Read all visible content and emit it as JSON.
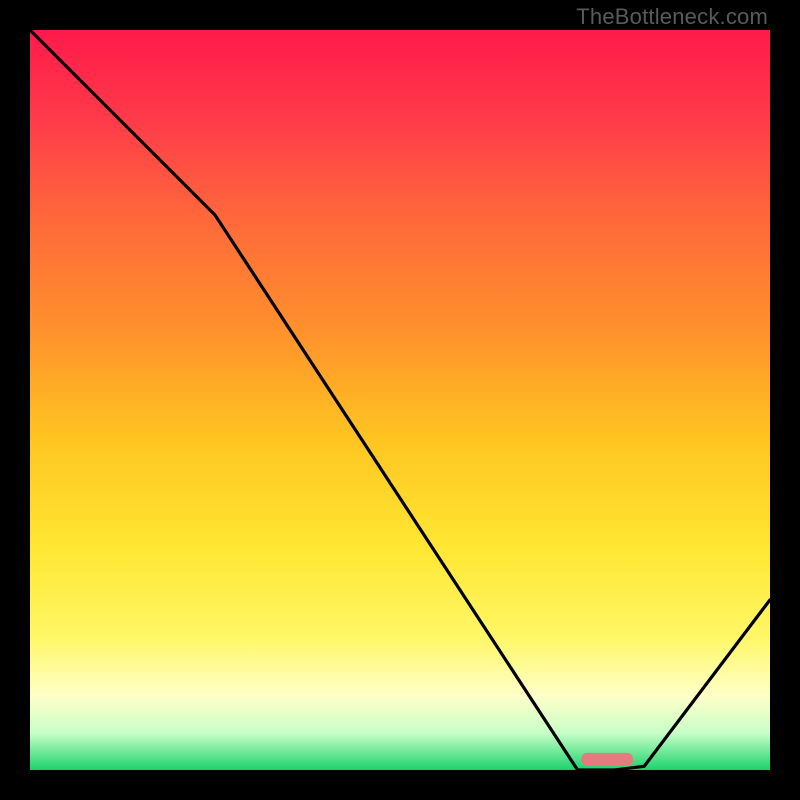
{
  "watermark": "TheBottleneck.com",
  "chart_data": {
    "type": "line",
    "title": "",
    "xlabel": "",
    "ylabel": "",
    "xlim": [
      0,
      100
    ],
    "ylim": [
      0,
      100
    ],
    "grid": false,
    "legend": false,
    "series": [
      {
        "name": "curve",
        "x": [
          0,
          25,
          74,
          79,
          83,
          100
        ],
        "y": [
          100,
          75,
          0,
          0,
          0.5,
          23
        ]
      }
    ],
    "marker": {
      "x_center": 78,
      "y": 1.5,
      "width": 7,
      "color": "#e77a7f"
    },
    "gradient_stops": [
      {
        "offset": 0.0,
        "color": "#ff1a4b"
      },
      {
        "offset": 0.12,
        "color": "#ff3a4a"
      },
      {
        "offset": 0.26,
        "color": "#ff6a3a"
      },
      {
        "offset": 0.4,
        "color": "#ff8f2d"
      },
      {
        "offset": 0.55,
        "color": "#ffc421"
      },
      {
        "offset": 0.7,
        "color": "#ffe733"
      },
      {
        "offset": 0.82,
        "color": "#fff766"
      },
      {
        "offset": 0.9,
        "color": "#ffffc8"
      },
      {
        "offset": 0.95,
        "color": "#c8ffc8"
      },
      {
        "offset": 1.0,
        "color": "#1bd36b"
      }
    ]
  }
}
